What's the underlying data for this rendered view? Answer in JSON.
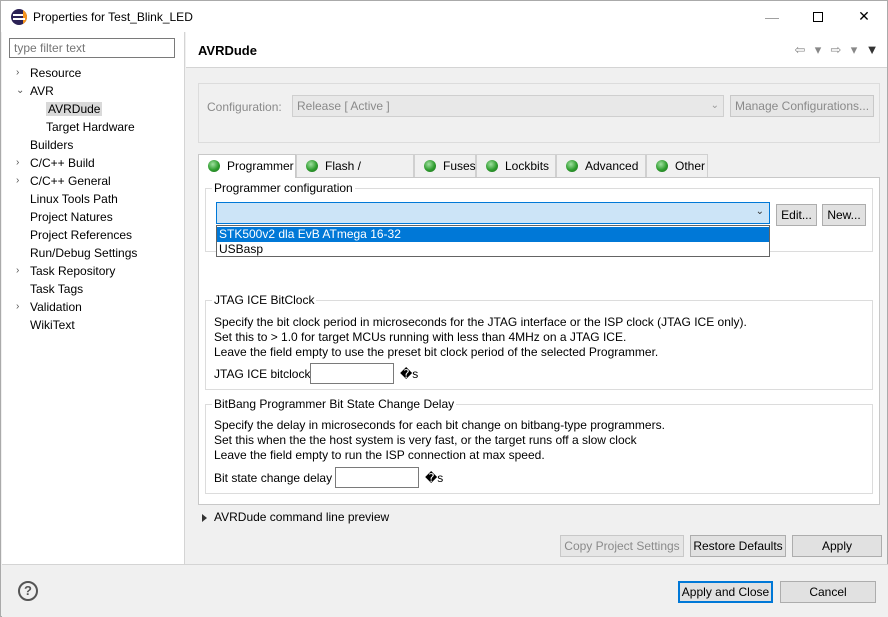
{
  "window": {
    "title": "Properties for Test_Blink_LED"
  },
  "window_controls": {
    "minimize": "—",
    "close": "✕"
  },
  "left": {
    "filter_placeholder": "type filter text",
    "tree": [
      {
        "label": "Resource",
        "expander": "›"
      },
      {
        "label": "AVR",
        "expander": "⌄"
      },
      {
        "label": "AVRDude",
        "expander": "",
        "selected": true
      },
      {
        "label": "Target Hardware",
        "expander": ""
      },
      {
        "label": "Builders",
        "expander": ""
      },
      {
        "label": "C/C++ Build",
        "expander": "›"
      },
      {
        "label": "C/C++ General",
        "expander": "›"
      },
      {
        "label": "Linux Tools Path",
        "expander": ""
      },
      {
        "label": "Project Natures",
        "expander": ""
      },
      {
        "label": "Project References",
        "expander": ""
      },
      {
        "label": "Run/Debug Settings",
        "expander": ""
      },
      {
        "label": "Task Repository",
        "expander": "›"
      },
      {
        "label": "Task Tags",
        "expander": ""
      },
      {
        "label": "Validation",
        "expander": "›"
      },
      {
        "label": "WikiText",
        "expander": ""
      }
    ]
  },
  "header": {
    "title": "AVRDude",
    "nav": {
      "back": "⇦",
      "back_menu": "▾",
      "forward": "⇨",
      "forward_menu": "▾",
      "menu": "▼"
    }
  },
  "configuration": {
    "label": "Configuration:",
    "value": "Release  [ Active ]",
    "chevron": "⌄",
    "manage_button": "Manage Configurations..."
  },
  "tabs": [
    {
      "label": "Programmer",
      "active": true
    },
    {
      "label": "Flash / EEPROM",
      "active": false
    },
    {
      "label": "Fuses",
      "active": false
    },
    {
      "label": "Lockbits",
      "active": false
    },
    {
      "label": "Advanced",
      "active": false
    },
    {
      "label": "Other",
      "active": false
    }
  ],
  "programmer": {
    "group_title": "Programmer configuration",
    "select_value": "",
    "chevron": "⌄",
    "edit_button": "Edit...",
    "new_button": "New...",
    "dropdown_options": [
      {
        "label": "STK500v2 dla EvB ATmega 16-32",
        "highlighted": true
      },
      {
        "label": "USBasp",
        "highlighted": false
      }
    ]
  },
  "jtag": {
    "group_title": "JTAG ICE BitClock",
    "lines": [
      "Specify the bit clock period in microseconds for the JTAG interface or the ISP clock (JTAG ICE only).",
      "Set this to > 1.0 for target MCUs running with less than 4MHz on a JTAG ICE.",
      "Leave the field empty to use the preset bit clock period of the selected Programmer."
    ],
    "field_label": "JTAG ICE bitclock",
    "field_value": "",
    "unit": "�s"
  },
  "bitbang": {
    "group_title": "BitBang Programmer Bit State Change Delay",
    "lines": [
      "Specify the delay in microseconds for each bit change on bitbang-type programmers.",
      "Set this when the the host system is very fast, or the target runs off a slow clock",
      "Leave the field empty to run the ISP connection at max speed."
    ],
    "field_label": "Bit state change delay",
    "field_value": "",
    "unit": "�s"
  },
  "command_preview": {
    "label": "AVRDude command line preview"
  },
  "page_buttons": {
    "copy": "Copy Project Settings",
    "restore": "Restore Defaults",
    "apply": "Apply"
  },
  "bottom": {
    "help": "?",
    "apply_close": "Apply and Close",
    "cancel": "Cancel"
  },
  "colors": {
    "selection": "#0078d7",
    "led_green": "#2e9c2e"
  }
}
